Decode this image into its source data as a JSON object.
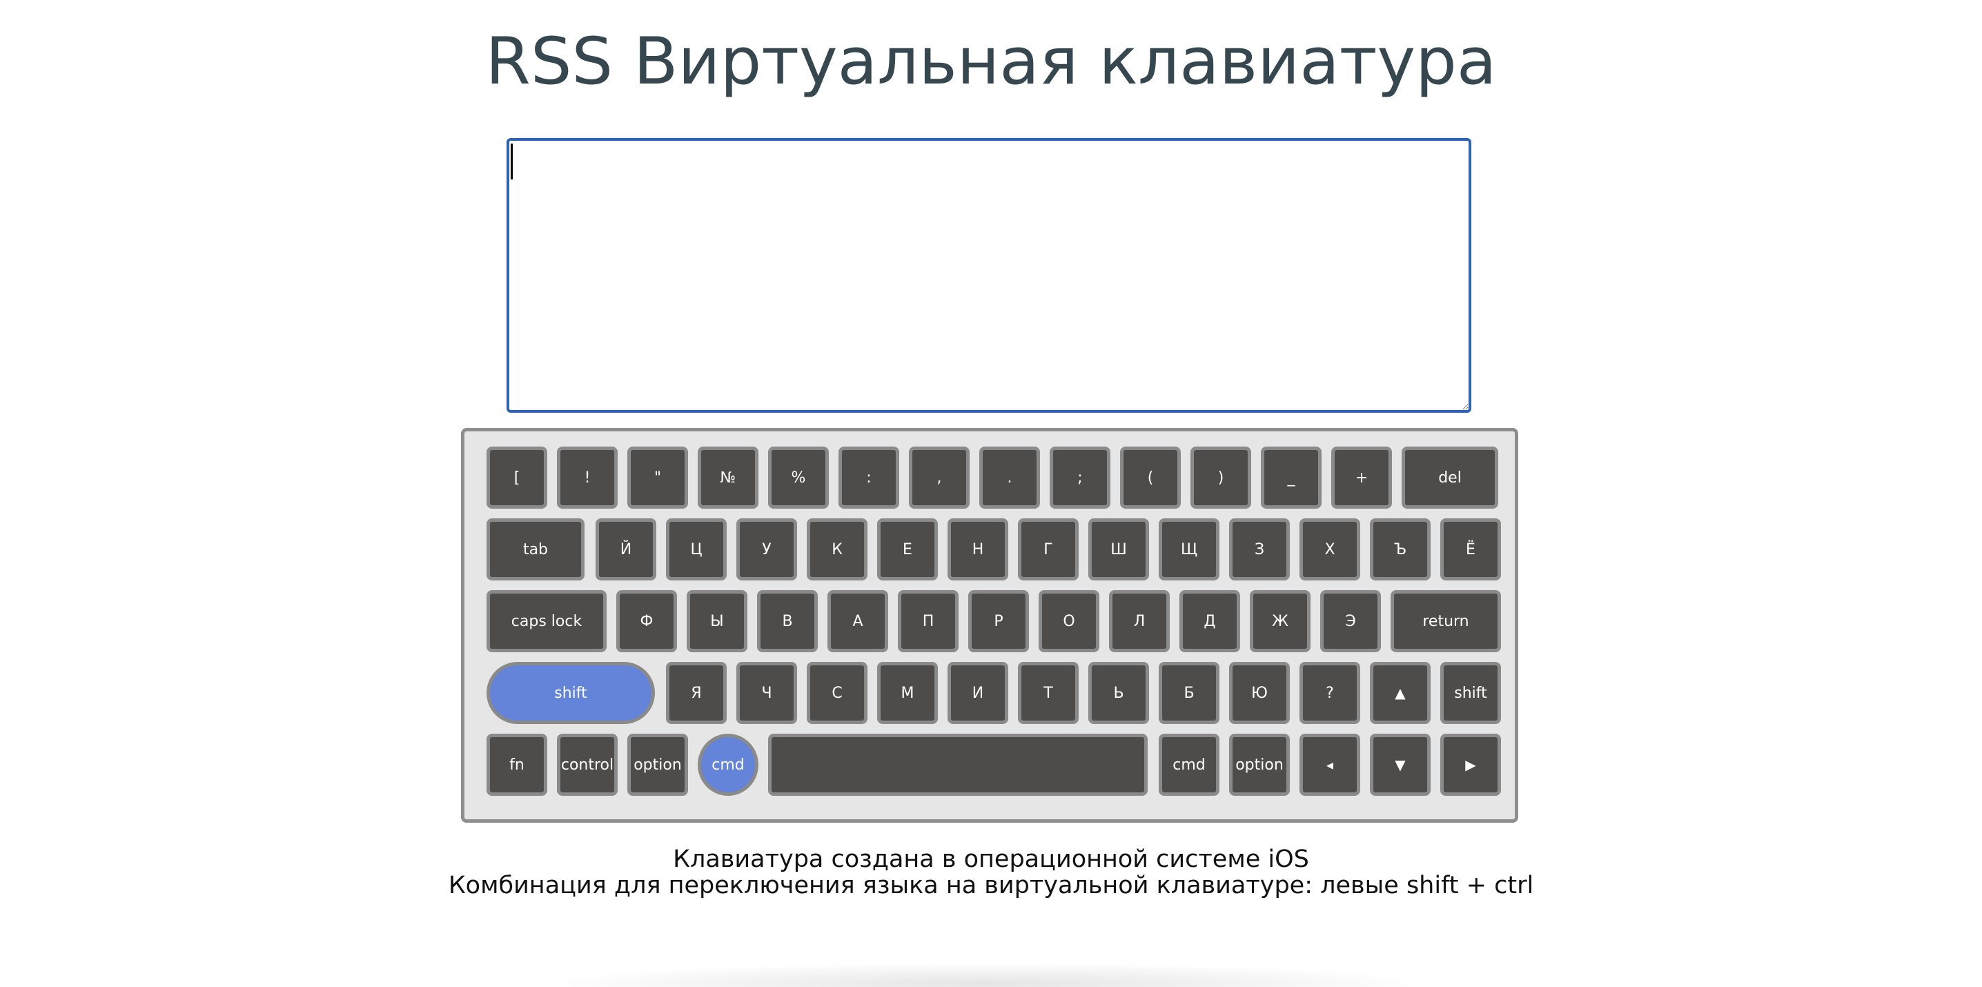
{
  "title": "RSS Виртуальная клавиатура",
  "textarea": {
    "value": "",
    "placeholder": ""
  },
  "colors": {
    "title": "#37474f",
    "key_bg": "#4d4c4a",
    "key_border": "#8a8a8a",
    "key_active": "#6384d9",
    "keyboard_bg": "#e6e6e6",
    "textarea_border": "#2e62b5"
  },
  "keyboard": {
    "rows": [
      [
        {
          "label": "[",
          "name": "key-bracket"
        },
        {
          "label": "!",
          "name": "key-exclamation"
        },
        {
          "label": "\"",
          "name": "key-quote"
        },
        {
          "label": "№",
          "name": "key-numero"
        },
        {
          "label": "%",
          "name": "key-percent"
        },
        {
          "label": ":",
          "name": "key-colon"
        },
        {
          "label": ",",
          "name": "key-comma"
        },
        {
          "label": ".",
          "name": "key-period"
        },
        {
          "label": ";",
          "name": "key-semicolon"
        },
        {
          "label": "(",
          "name": "key-paren-left"
        },
        {
          "label": ")",
          "name": "key-paren-right"
        },
        {
          "label": "_",
          "name": "key-underscore"
        },
        {
          "label": "+",
          "name": "key-plus"
        },
        {
          "label": "del",
          "name": "key-del"
        }
      ],
      [
        {
          "label": "tab",
          "name": "key-tab"
        },
        {
          "label": "Й",
          "name": "key-iy"
        },
        {
          "label": "Ц",
          "name": "key-ts"
        },
        {
          "label": "У",
          "name": "key-u"
        },
        {
          "label": "К",
          "name": "key-k"
        },
        {
          "label": "Е",
          "name": "key-ye"
        },
        {
          "label": "Н",
          "name": "key-n"
        },
        {
          "label": "Г",
          "name": "key-g"
        },
        {
          "label": "Ш",
          "name": "key-sh"
        },
        {
          "label": "Щ",
          "name": "key-shch"
        },
        {
          "label": "З",
          "name": "key-z"
        },
        {
          "label": "Х",
          "name": "key-kh"
        },
        {
          "label": "Ъ",
          "name": "key-hard-sign"
        },
        {
          "label": "Ё",
          "name": "key-yo"
        }
      ],
      [
        {
          "label": "caps lock",
          "name": "key-caps-lock"
        },
        {
          "label": "Ф",
          "name": "key-f"
        },
        {
          "label": "Ы",
          "name": "key-y"
        },
        {
          "label": "В",
          "name": "key-v"
        },
        {
          "label": "А",
          "name": "key-a"
        },
        {
          "label": "П",
          "name": "key-p"
        },
        {
          "label": "Р",
          "name": "key-r"
        },
        {
          "label": "О",
          "name": "key-o"
        },
        {
          "label": "Л",
          "name": "key-l"
        },
        {
          "label": "Д",
          "name": "key-d"
        },
        {
          "label": "Ж",
          "name": "key-zh"
        },
        {
          "label": "Э",
          "name": "key-e"
        },
        {
          "label": "return",
          "name": "key-return"
        }
      ],
      [
        {
          "label": "shift",
          "name": "key-shift-left",
          "active": true
        },
        {
          "label": "Я",
          "name": "key-ya"
        },
        {
          "label": "Ч",
          "name": "key-ch"
        },
        {
          "label": "С",
          "name": "key-s"
        },
        {
          "label": "М",
          "name": "key-m"
        },
        {
          "label": "И",
          "name": "key-i"
        },
        {
          "label": "Т",
          "name": "key-t"
        },
        {
          "label": "Ь",
          "name": "key-soft-sign"
        },
        {
          "label": "Б",
          "name": "key-b"
        },
        {
          "label": "Ю",
          "name": "key-yu"
        },
        {
          "label": "?",
          "name": "key-question"
        },
        {
          "label": "▲",
          "name": "key-arrow-up",
          "icon": "arrow-up-icon"
        },
        {
          "label": "shift",
          "name": "key-shift-right"
        }
      ],
      [
        {
          "label": "fn",
          "name": "key-fn"
        },
        {
          "label": "control",
          "name": "key-control"
        },
        {
          "label": "option",
          "name": "key-option-left"
        },
        {
          "label": "cmd",
          "name": "key-cmd-left",
          "active": true
        },
        {
          "label": "",
          "name": "key-space"
        },
        {
          "label": "cmd",
          "name": "key-cmd-right"
        },
        {
          "label": "option",
          "name": "key-option-right"
        },
        {
          "label": "◂",
          "name": "key-arrow-left",
          "icon": "arrow-left-icon"
        },
        {
          "label": "▼",
          "name": "key-arrow-down",
          "icon": "arrow-down-icon"
        },
        {
          "label": "▶",
          "name": "key-arrow-right",
          "icon": "arrow-right-icon"
        }
      ]
    ]
  },
  "footer": {
    "line1": "Клавиатура создана в операционной системе iOS",
    "line2": "Комбинация для переключения языка на виртуальной клавиатуре: левые shift + ctrl"
  }
}
